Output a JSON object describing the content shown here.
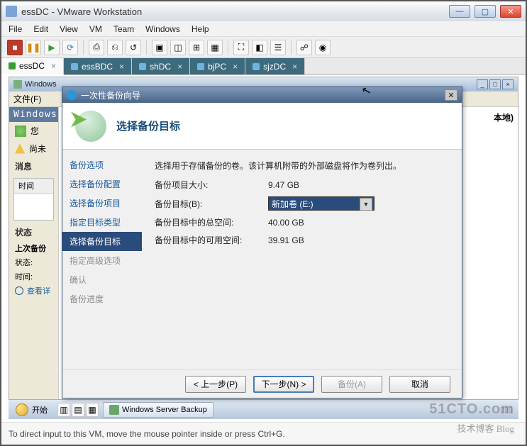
{
  "window": {
    "title": "essDC - VMware Workstation",
    "status": "To direct input to this VM, move the mouse pointer inside or press Ctrl+G."
  },
  "menu": {
    "file": "File",
    "edit": "Edit",
    "view": "View",
    "vm": "VM",
    "team": "Team",
    "windows": "Windows",
    "help": "Help"
  },
  "tabs": [
    {
      "label": "essDC",
      "active": true
    },
    {
      "label": "essBDC",
      "active": false
    },
    {
      "label": "shDC",
      "active": false
    },
    {
      "label": "bjPC",
      "active": false
    },
    {
      "label": "sjzDC",
      "active": false
    }
  ],
  "inner": {
    "title": "Windows",
    "file_menu": "文件(F)",
    "header": "Windows",
    "you": "您",
    "warn": "尚未",
    "msg_label": "消息",
    "time_label": "时间",
    "status_label": "状态",
    "last_backup": "上次备份",
    "status2": "状态:",
    "time2": "时间:",
    "view": "查看详",
    "local": "本地)"
  },
  "taskbar": {
    "start": "开始",
    "app": "Windows Server Backup"
  },
  "wizard": {
    "title": "一次性备份向导",
    "heading": "选择备份目标",
    "nav": {
      "opt": "备份选项",
      "cfg": "选择备份配置",
      "items": "选择备份项目",
      "dtype": "指定目标类型",
      "dtarget": "选择备份目标",
      "adv": "指定高级选项",
      "confirm": "确认",
      "progress": "备份进度"
    },
    "intro": "选择用于存储备份的卷。该计算机附带的外部磁盘将作为卷列出。",
    "size_label": "备份项目大小:",
    "size_val": "9.47 GB",
    "target_label": "备份目标(B):",
    "target_val": "新加卷 (E:)",
    "total_label": "备份目标中的总空间:",
    "total_val": "40.00 GB",
    "free_label": "备份目标中的可用空间:",
    "free_val": "39.91 GB",
    "prev": "< 上一步(P)",
    "next": "下一步(N) >",
    "backup": "备份(A)",
    "cancel": "取消"
  },
  "watermark": "51CTO.com",
  "watermark2": "技术博客  Blog"
}
